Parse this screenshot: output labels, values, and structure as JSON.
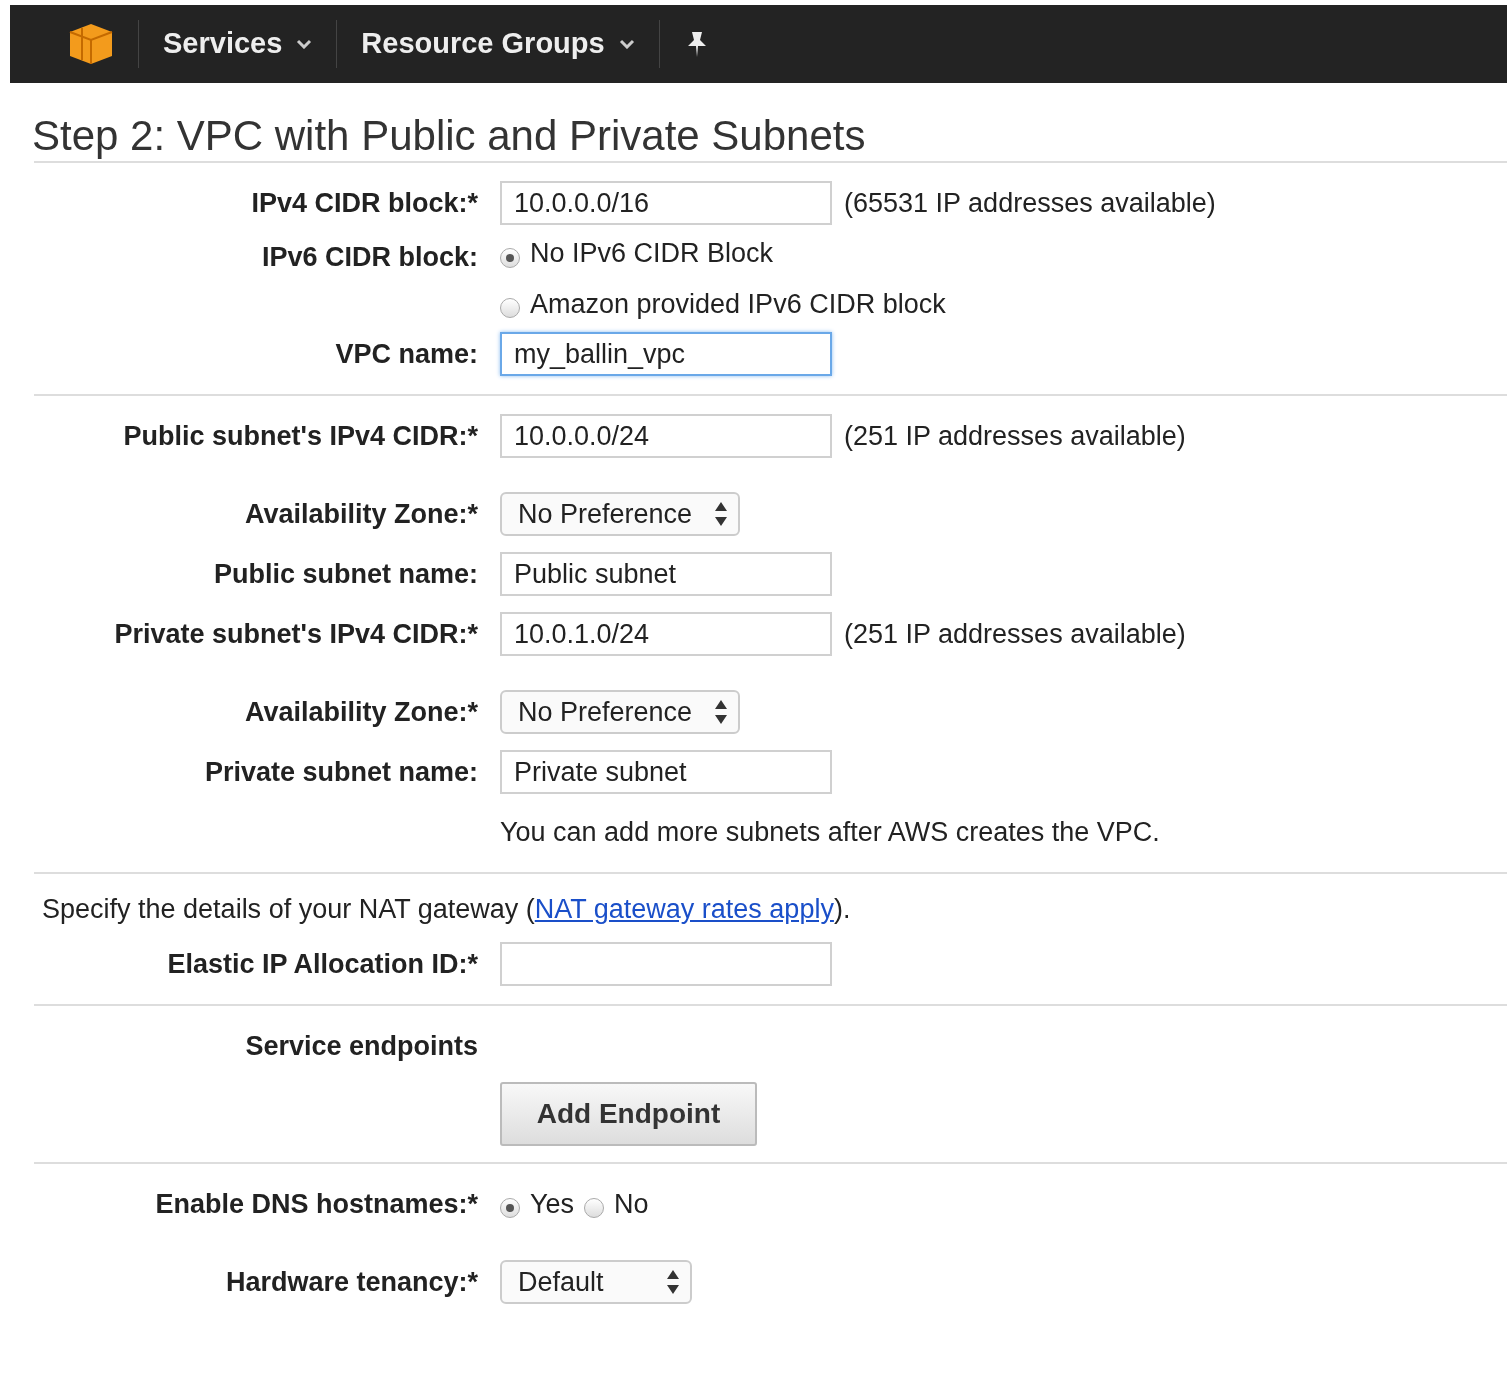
{
  "nav": {
    "items": [
      {
        "kind": "dropdown",
        "label": "Services"
      },
      {
        "kind": "dropdown",
        "label": "Resource Groups"
      },
      {
        "kind": "pin"
      }
    ]
  },
  "title": "Step 2: VPC with Public and Private Subnets",
  "sections": [
    {
      "rows": [
        {
          "kind": "input",
          "label": "IPv4 CIDR block:*",
          "value": "10.0.0.0/16",
          "note": "(65531 IP addresses available)",
          "focused": false
        },
        {
          "kind": "radio",
          "label": "IPv6 CIDR block:",
          "options": [
            {
              "label": "No IPv6 CIDR Block",
              "selected": true
            },
            {
              "label": "Amazon provided IPv6 CIDR block",
              "selected": false
            }
          ]
        },
        {
          "kind": "input",
          "label": "VPC name:",
          "value": "my_ballin_vpc",
          "focused": true
        }
      ]
    },
    {
      "rows": [
        {
          "kind": "input",
          "label": "Public subnet's IPv4 CIDR:*",
          "value": "10.0.0.0/24",
          "note": "(251 IP addresses available)",
          "focused": false
        },
        {
          "kind": "select",
          "label": "Availability Zone:*",
          "value": "No Preference"
        },
        {
          "kind": "input",
          "label": "Public subnet name:",
          "value": "Public subnet",
          "focused": false
        },
        {
          "kind": "input",
          "label": "Private subnet's IPv4 CIDR:*",
          "value": "10.0.1.0/24",
          "note": "(251 IP addresses available)",
          "focused": false
        },
        {
          "kind": "select",
          "label": "Availability Zone:*",
          "value": "No Preference"
        },
        {
          "kind": "input",
          "label": "Private subnet name:",
          "value": "Private subnet",
          "focused": false
        },
        {
          "kind": "help",
          "text": "You can add more subnets after AWS creates the VPC."
        }
      ]
    },
    {
      "rows": [
        {
          "kind": "sentence",
          "before": "Specify the details of your NAT gateway (",
          "link": "NAT gateway rates apply",
          "after": ")."
        },
        {
          "kind": "input",
          "label": "Elastic IP Allocation ID:*",
          "value": "",
          "focused": false
        }
      ]
    },
    {
      "rows": [
        {
          "kind": "heading",
          "label": "Service endpoints"
        },
        {
          "kind": "button",
          "label": "Add Endpoint"
        }
      ]
    },
    {
      "rows": [
        {
          "kind": "radio-inline",
          "label": "Enable DNS hostnames:*",
          "options": [
            {
              "label": "Yes",
              "selected": true
            },
            {
              "label": "No",
              "selected": false
            }
          ]
        },
        {
          "kind": "select",
          "label": "Hardware tenancy:*",
          "value": "Default"
        }
      ]
    }
  ]
}
